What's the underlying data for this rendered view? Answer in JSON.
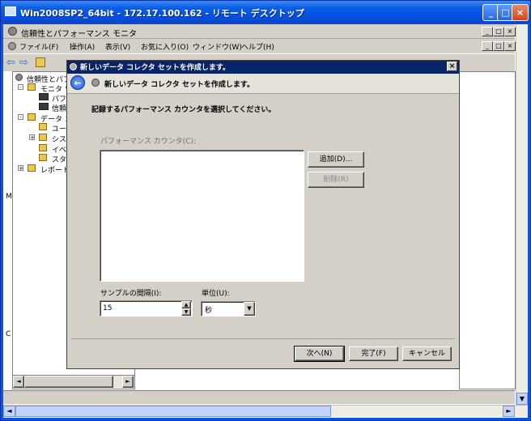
{
  "outer_window": {
    "title": "Win2008SP2_64bit - 172.17.100.162 - リモート デスクトップ",
    "buttons": {
      "minimize": "_",
      "maximize": "□",
      "close": "×"
    }
  },
  "mmc": {
    "title": "信頼性とパフォーマンス モニタ",
    "menu": [
      "ファイル(F)",
      "操作(A)",
      "表示(V)",
      "お気に入り(O)",
      "ウィンドウ(W)",
      "ヘルプ(H)"
    ],
    "tree": [
      {
        "label": "信頼性とパフ"
      },
      {
        "label": "モニタ ツ"
      },
      {
        "label": "パフォ"
      },
      {
        "label": "信頼"
      },
      {
        "label": "データ コ"
      },
      {
        "label": "ユー"
      },
      {
        "label": "シス"
      },
      {
        "label": "イベ"
      },
      {
        "label": "スタ"
      },
      {
        "label": "レポート"
      }
    ],
    "left_edge_letters": [
      "M",
      "C"
    ]
  },
  "dialog": {
    "title": "新しいデータ コレクタ セットを作成します。",
    "header": "新しいデータ コレクタ セットを作成します。",
    "instruction": "記録するパフォーマンス カウンタを選択してください。",
    "counters_label": "パフォーマンス カウンタ(C):",
    "add_button": "追加(D)...",
    "remove_button": "削除(R)",
    "sample_interval_label": "サンプルの間隔(I):",
    "sample_interval_value": "15",
    "unit_label": "単位(U):",
    "unit_value": "秒",
    "next_button": "次へ(N)",
    "finish_button": "完了(F)",
    "cancel_button": "キャンセル"
  }
}
